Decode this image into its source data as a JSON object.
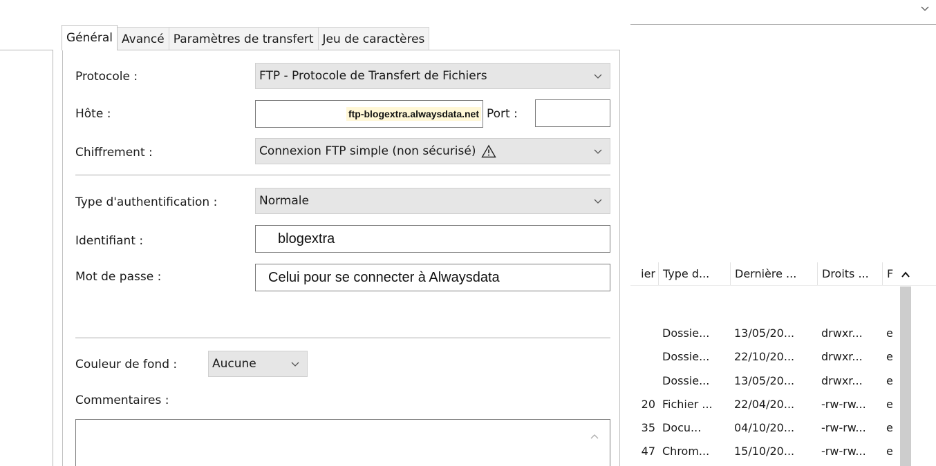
{
  "dialog": {
    "tabs": [
      {
        "label": "Général",
        "active": true
      },
      {
        "label": "Avancé",
        "active": false
      },
      {
        "label": "Paramètres de transfert",
        "active": false
      },
      {
        "label": "Jeu de caractères",
        "active": false
      }
    ],
    "protocol": {
      "label": "Protocole :",
      "value": "FTP - Protocole de Transfert de Fichiers"
    },
    "host": {
      "label": "Hôte :",
      "value": "ftp-blogextra.alwaysdata.net"
    },
    "port": {
      "label": "Port :",
      "value": ""
    },
    "encryption": {
      "label": "Chiffrement :",
      "value": "Connexion FTP simple (non sécurisé)",
      "icon": "warning-icon"
    },
    "auth_type": {
      "label": "Type d'authentification :",
      "value": "Normale"
    },
    "user": {
      "label": "Identifiant :",
      "value": "blogextra"
    },
    "password": {
      "label": "Mot de passe :",
      "value": "Celui pour se connecter à Alwaysdata"
    },
    "bg_color": {
      "label": "Couleur de fond :",
      "value": "Aucune"
    },
    "comments": {
      "label": "Commentaires :",
      "value": ""
    }
  },
  "file_list": {
    "headers": [
      "ier",
      "Type d...",
      "Dernière ...",
      "Droits ...",
      "F"
    ],
    "rows": [
      [
        "",
        "Dossie...",
        "13/05/20...",
        "drwxr...",
        "e"
      ],
      [
        "",
        "Dossie...",
        "22/10/20...",
        "drwxr...",
        "e"
      ],
      [
        "",
        "Dossie...",
        "13/05/20...",
        "drwxr...",
        "e"
      ],
      [
        "20",
        "Fichier ...",
        "22/04/20...",
        "-rw-rw...",
        "e"
      ],
      [
        "35",
        "Docu...",
        "04/10/20...",
        "-rw-rw...",
        "e"
      ],
      [
        "47",
        "Chrom...",
        "15/10/20...",
        "-rw-rw...",
        "e"
      ]
    ]
  },
  "colors": {
    "highlight": "#fff7d6",
    "combo_bg": "#e6e6e6",
    "scrollbar": "#cdcdcd"
  }
}
